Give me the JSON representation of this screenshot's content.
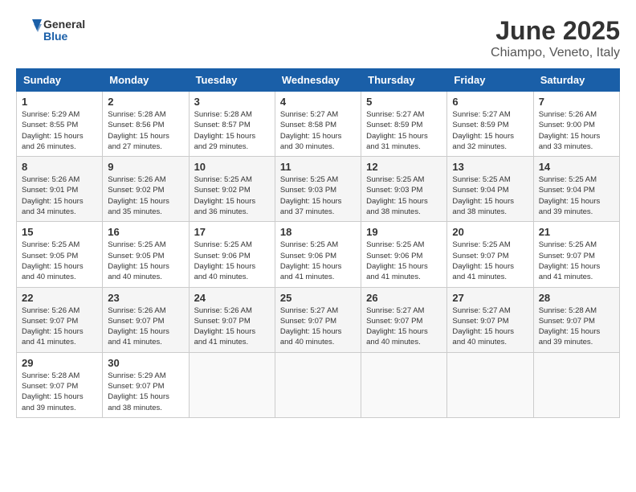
{
  "header": {
    "logo_general": "General",
    "logo_blue": "Blue",
    "title": "June 2025",
    "subtitle": "Chiampo, Veneto, Italy"
  },
  "weekdays": [
    "Sunday",
    "Monday",
    "Tuesday",
    "Wednesday",
    "Thursday",
    "Friday",
    "Saturday"
  ],
  "weeks": [
    [
      {
        "day": "1",
        "detail": "Sunrise: 5:29 AM\nSunset: 8:55 PM\nDaylight: 15 hours\nand 26 minutes."
      },
      {
        "day": "2",
        "detail": "Sunrise: 5:28 AM\nSunset: 8:56 PM\nDaylight: 15 hours\nand 27 minutes."
      },
      {
        "day": "3",
        "detail": "Sunrise: 5:28 AM\nSunset: 8:57 PM\nDaylight: 15 hours\nand 29 minutes."
      },
      {
        "day": "4",
        "detail": "Sunrise: 5:27 AM\nSunset: 8:58 PM\nDaylight: 15 hours\nand 30 minutes."
      },
      {
        "day": "5",
        "detail": "Sunrise: 5:27 AM\nSunset: 8:59 PM\nDaylight: 15 hours\nand 31 minutes."
      },
      {
        "day": "6",
        "detail": "Sunrise: 5:27 AM\nSunset: 8:59 PM\nDaylight: 15 hours\nand 32 minutes."
      },
      {
        "day": "7",
        "detail": "Sunrise: 5:26 AM\nSunset: 9:00 PM\nDaylight: 15 hours\nand 33 minutes."
      }
    ],
    [
      {
        "day": "8",
        "detail": "Sunrise: 5:26 AM\nSunset: 9:01 PM\nDaylight: 15 hours\nand 34 minutes."
      },
      {
        "day": "9",
        "detail": "Sunrise: 5:26 AM\nSunset: 9:02 PM\nDaylight: 15 hours\nand 35 minutes."
      },
      {
        "day": "10",
        "detail": "Sunrise: 5:25 AM\nSunset: 9:02 PM\nDaylight: 15 hours\nand 36 minutes."
      },
      {
        "day": "11",
        "detail": "Sunrise: 5:25 AM\nSunset: 9:03 PM\nDaylight: 15 hours\nand 37 minutes."
      },
      {
        "day": "12",
        "detail": "Sunrise: 5:25 AM\nSunset: 9:03 PM\nDaylight: 15 hours\nand 38 minutes."
      },
      {
        "day": "13",
        "detail": "Sunrise: 5:25 AM\nSunset: 9:04 PM\nDaylight: 15 hours\nand 38 minutes."
      },
      {
        "day": "14",
        "detail": "Sunrise: 5:25 AM\nSunset: 9:04 PM\nDaylight: 15 hours\nand 39 minutes."
      }
    ],
    [
      {
        "day": "15",
        "detail": "Sunrise: 5:25 AM\nSunset: 9:05 PM\nDaylight: 15 hours\nand 40 minutes."
      },
      {
        "day": "16",
        "detail": "Sunrise: 5:25 AM\nSunset: 9:05 PM\nDaylight: 15 hours\nand 40 minutes."
      },
      {
        "day": "17",
        "detail": "Sunrise: 5:25 AM\nSunset: 9:06 PM\nDaylight: 15 hours\nand 40 minutes."
      },
      {
        "day": "18",
        "detail": "Sunrise: 5:25 AM\nSunset: 9:06 PM\nDaylight: 15 hours\nand 41 minutes."
      },
      {
        "day": "19",
        "detail": "Sunrise: 5:25 AM\nSunset: 9:06 PM\nDaylight: 15 hours\nand 41 minutes."
      },
      {
        "day": "20",
        "detail": "Sunrise: 5:25 AM\nSunset: 9:07 PM\nDaylight: 15 hours\nand 41 minutes."
      },
      {
        "day": "21",
        "detail": "Sunrise: 5:25 AM\nSunset: 9:07 PM\nDaylight: 15 hours\nand 41 minutes."
      }
    ],
    [
      {
        "day": "22",
        "detail": "Sunrise: 5:26 AM\nSunset: 9:07 PM\nDaylight: 15 hours\nand 41 minutes."
      },
      {
        "day": "23",
        "detail": "Sunrise: 5:26 AM\nSunset: 9:07 PM\nDaylight: 15 hours\nand 41 minutes."
      },
      {
        "day": "24",
        "detail": "Sunrise: 5:26 AM\nSunset: 9:07 PM\nDaylight: 15 hours\nand 41 minutes."
      },
      {
        "day": "25",
        "detail": "Sunrise: 5:27 AM\nSunset: 9:07 PM\nDaylight: 15 hours\nand 40 minutes."
      },
      {
        "day": "26",
        "detail": "Sunrise: 5:27 AM\nSunset: 9:07 PM\nDaylight: 15 hours\nand 40 minutes."
      },
      {
        "day": "27",
        "detail": "Sunrise: 5:27 AM\nSunset: 9:07 PM\nDaylight: 15 hours\nand 40 minutes."
      },
      {
        "day": "28",
        "detail": "Sunrise: 5:28 AM\nSunset: 9:07 PM\nDaylight: 15 hours\nand 39 minutes."
      }
    ],
    [
      {
        "day": "29",
        "detail": "Sunrise: 5:28 AM\nSunset: 9:07 PM\nDaylight: 15 hours\nand 39 minutes."
      },
      {
        "day": "30",
        "detail": "Sunrise: 5:29 AM\nSunset: 9:07 PM\nDaylight: 15 hours\nand 38 minutes."
      },
      {
        "day": "",
        "detail": ""
      },
      {
        "day": "",
        "detail": ""
      },
      {
        "day": "",
        "detail": ""
      },
      {
        "day": "",
        "detail": ""
      },
      {
        "day": "",
        "detail": ""
      }
    ]
  ]
}
